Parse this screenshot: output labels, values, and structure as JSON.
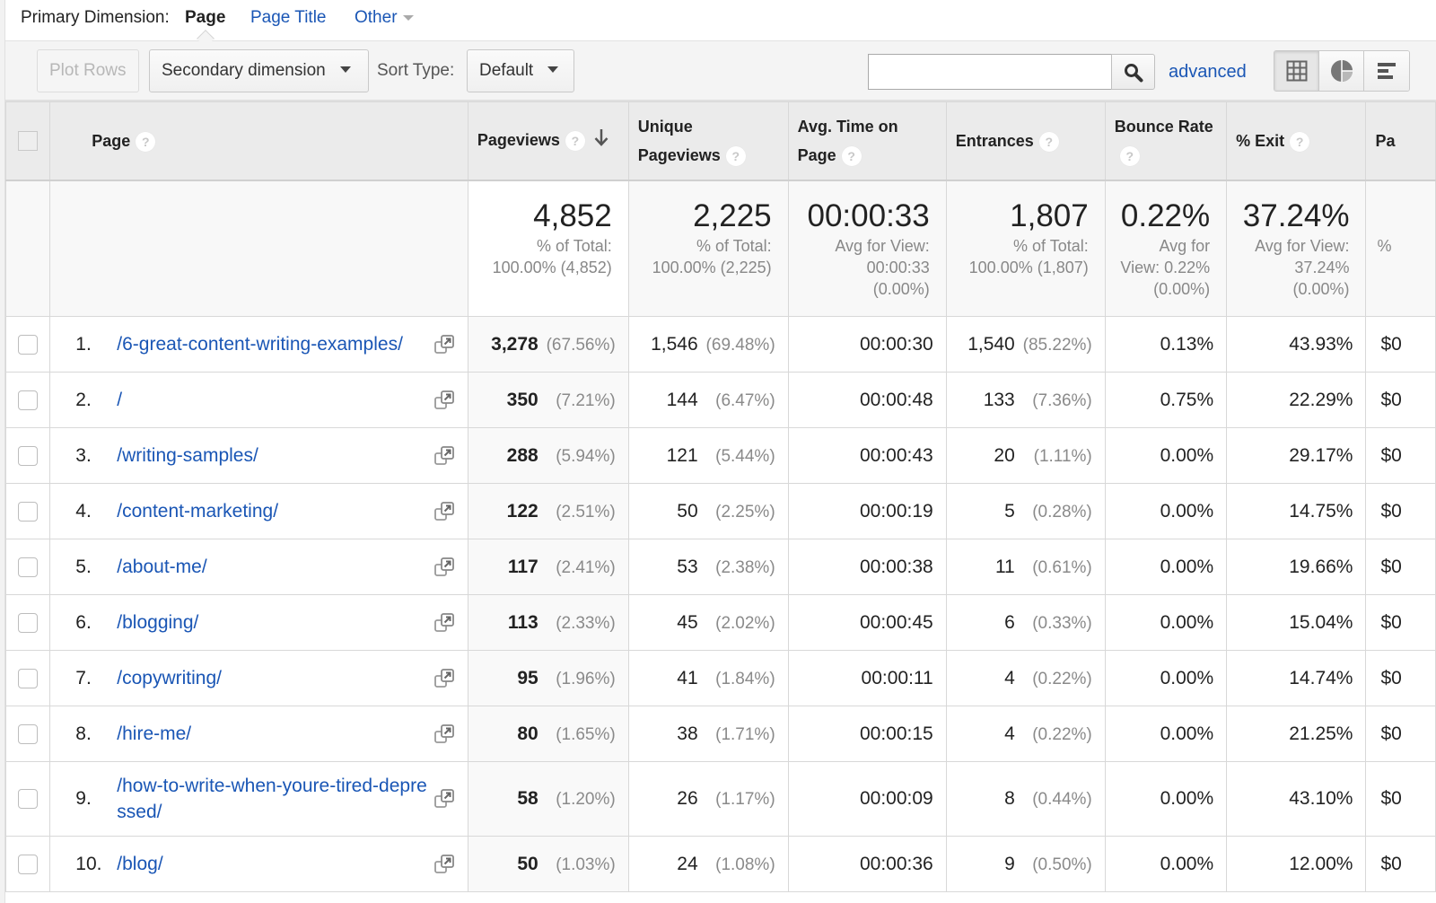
{
  "primary_dimension": {
    "label": "Primary Dimension:",
    "active": "Page",
    "links": [
      "Page Title",
      "Other"
    ]
  },
  "toolbar": {
    "plot_rows": "Plot Rows",
    "secondary_dimension": "Secondary dimension",
    "sort_type_label": "Sort Type:",
    "sort_type_value": "Default",
    "search_value": "",
    "advanced": "advanced",
    "view_icons": [
      "grid-view-icon",
      "pie-view-icon",
      "bar-view-icon"
    ]
  },
  "table": {
    "columns": [
      {
        "label": "Page",
        "help": "?"
      },
      {
        "label": "Pageviews",
        "help": "?",
        "sorted": "descending"
      },
      {
        "label": "Unique Pageviews",
        "help": "?"
      },
      {
        "label": "Avg. Time on Page",
        "help": "?"
      },
      {
        "label": "Entrances",
        "help": "?"
      },
      {
        "label": "Bounce Rate",
        "help": "?"
      },
      {
        "label": "% Exit",
        "help": "?"
      },
      {
        "label": "Pa"
      }
    ],
    "summary": {
      "pageviews": {
        "value": "4,852",
        "line1": "% of Total:",
        "line2": "100.00% (4,852)"
      },
      "unique_pageviews": {
        "value": "2,225",
        "line1": "% of Total:",
        "line2": "100.00% (2,225)"
      },
      "avg_time": {
        "value": "00:00:33",
        "line1": "Avg for View:",
        "line2": "00:00:33",
        "line3": "(0.00%)"
      },
      "entrances": {
        "value": "1,807",
        "line1": "% of Total:",
        "line2": "100.00% (1,807)"
      },
      "bounce_rate": {
        "value": "0.22%",
        "line1": "Avg for",
        "line2": "View: 0.22%",
        "line3": "(0.00%)"
      },
      "exit": {
        "value": "37.24%",
        "line1": "Avg for View:",
        "line2": "37.24%",
        "line3": "(0.00%)"
      },
      "page_value": {
        "line1": "%"
      }
    },
    "rows": [
      {
        "idx": "1.",
        "page": "/6-great-content-writing-examples/",
        "pv": "3,278",
        "pv_pct": "(67.56%)",
        "upv": "1,546",
        "upv_pct": "(69.48%)",
        "time": "00:00:30",
        "ent": "1,540",
        "ent_pct": "(85.22%)",
        "bounce": "0.13%",
        "exit": "43.93%",
        "value": "$0"
      },
      {
        "idx": "2.",
        "page": "/",
        "pv": "350",
        "pv_pct": "(7.21%)",
        "upv": "144",
        "upv_pct": "(6.47%)",
        "time": "00:00:48",
        "ent": "133",
        "ent_pct": "(7.36%)",
        "bounce": "0.75%",
        "exit": "22.29%",
        "value": "$0"
      },
      {
        "idx": "3.",
        "page": "/writing-samples/",
        "pv": "288",
        "pv_pct": "(5.94%)",
        "upv": "121",
        "upv_pct": "(5.44%)",
        "time": "00:00:43",
        "ent": "20",
        "ent_pct": "(1.11%)",
        "bounce": "0.00%",
        "exit": "29.17%",
        "value": "$0"
      },
      {
        "idx": "4.",
        "page": "/content-marketing/",
        "pv": "122",
        "pv_pct": "(2.51%)",
        "upv": "50",
        "upv_pct": "(2.25%)",
        "time": "00:00:19",
        "ent": "5",
        "ent_pct": "(0.28%)",
        "bounce": "0.00%",
        "exit": "14.75%",
        "value": "$0"
      },
      {
        "idx": "5.",
        "page": "/about-me/",
        "pv": "117",
        "pv_pct": "(2.41%)",
        "upv": "53",
        "upv_pct": "(2.38%)",
        "time": "00:00:38",
        "ent": "11",
        "ent_pct": "(0.61%)",
        "bounce": "0.00%",
        "exit": "19.66%",
        "value": "$0"
      },
      {
        "idx": "6.",
        "page": "/blogging/",
        "pv": "113",
        "pv_pct": "(2.33%)",
        "upv": "45",
        "upv_pct": "(2.02%)",
        "time": "00:00:45",
        "ent": "6",
        "ent_pct": "(0.33%)",
        "bounce": "0.00%",
        "exit": "15.04%",
        "value": "$0"
      },
      {
        "idx": "7.",
        "page": "/copywriting/",
        "pv": "95",
        "pv_pct": "(1.96%)",
        "upv": "41",
        "upv_pct": "(1.84%)",
        "time": "00:00:11",
        "ent": "4",
        "ent_pct": "(0.22%)",
        "bounce": "0.00%",
        "exit": "14.74%",
        "value": "$0"
      },
      {
        "idx": "8.",
        "page": "/hire-me/",
        "pv": "80",
        "pv_pct": "(1.65%)",
        "upv": "38",
        "upv_pct": "(1.71%)",
        "time": "00:00:15",
        "ent": "4",
        "ent_pct": "(0.22%)",
        "bounce": "0.00%",
        "exit": "21.25%",
        "value": "$0"
      },
      {
        "idx": "9.",
        "page": "/how-to-write-when-youre-tired-depressed/",
        "pv": "58",
        "pv_pct": "(1.20%)",
        "upv": "26",
        "upv_pct": "(1.17%)",
        "time": "00:00:09",
        "ent": "8",
        "ent_pct": "(0.44%)",
        "bounce": "0.00%",
        "exit": "43.10%",
        "value": "$0"
      },
      {
        "idx": "10.",
        "page": "/blog/",
        "pv": "50",
        "pv_pct": "(1.03%)",
        "upv": "24",
        "upv_pct": "(1.08%)",
        "time": "00:00:36",
        "ent": "9",
        "ent_pct": "(0.50%)",
        "bounce": "0.00%",
        "exit": "12.00%",
        "value": "$0"
      }
    ]
  },
  "colors": {
    "link": "#1a56b5",
    "header_bg": "#ebebeb",
    "muted_text": "#8a8a8a"
  }
}
